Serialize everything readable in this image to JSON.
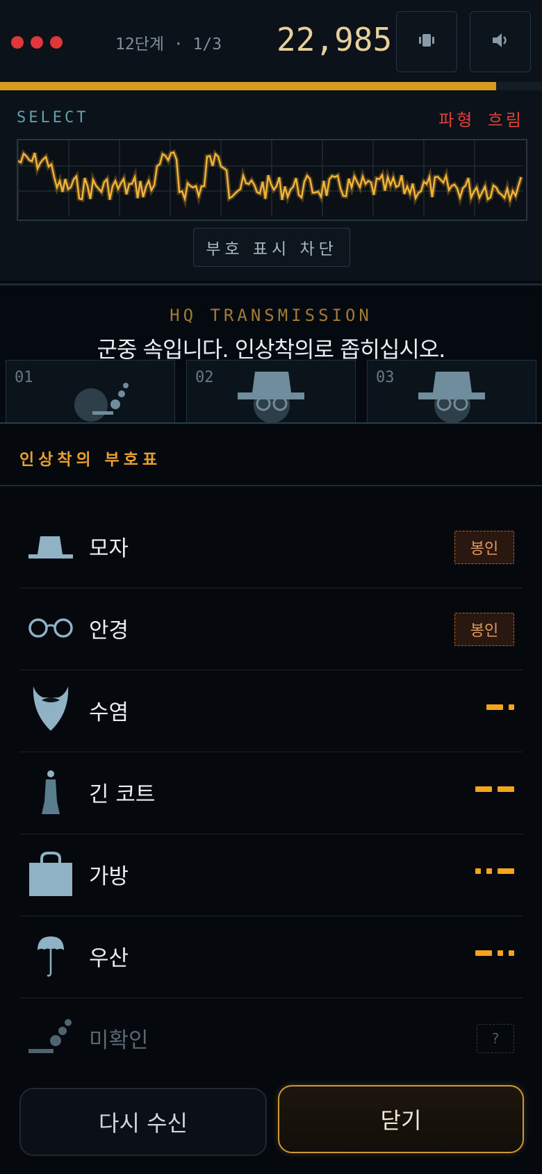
{
  "header": {
    "stage": "12단계 · 1/3",
    "score": "22,985",
    "icons": [
      "vibrate-icon",
      "speaker-icon"
    ],
    "progress_fraction": 0.915,
    "colors": {
      "alert": "#e0373a",
      "accent": "#d79b1f",
      "score": "#e9cf9a"
    }
  },
  "signal": {
    "select_label": "SELECT",
    "flow_label": "파형 흐림",
    "block_button": "부호 표시 차단"
  },
  "transmission": {
    "title": "HQ TRANSMISSION",
    "message": "군중 속입니다. 인상착의로 좁히십시오."
  },
  "suspects": [
    {
      "num": "01",
      "icon": "unknown-silhouette-icon"
    },
    {
      "num": "02",
      "icon": "hat-glasses-silhouette-icon"
    },
    {
      "num": "03",
      "icon": "hat-glasses-silhouette-icon"
    }
  ],
  "codebook": {
    "title": "인상착의 부호표",
    "items": [
      {
        "label": "모자",
        "icon": "hat-icon",
        "status": "sealed",
        "status_label": "봉인"
      },
      {
        "label": "안경",
        "icon": "glasses-icon",
        "status": "sealed",
        "status_label": "봉인"
      },
      {
        "label": "수염",
        "icon": "beard-icon",
        "status": "morse",
        "morse": "-."
      },
      {
        "label": "긴 코트",
        "icon": "long-coat-icon",
        "status": "morse",
        "morse": "--"
      },
      {
        "label": "가방",
        "icon": "bag-icon",
        "status": "morse",
        "morse": "..-"
      },
      {
        "label": "우산",
        "icon": "umbrella-icon",
        "status": "morse",
        "morse": "-.."
      },
      {
        "label": "미확인",
        "icon": "unknown-icon",
        "status": "unknown",
        "status_label": "?"
      }
    ]
  },
  "footer": {
    "retry": "다시 수신",
    "close": "닫기"
  }
}
